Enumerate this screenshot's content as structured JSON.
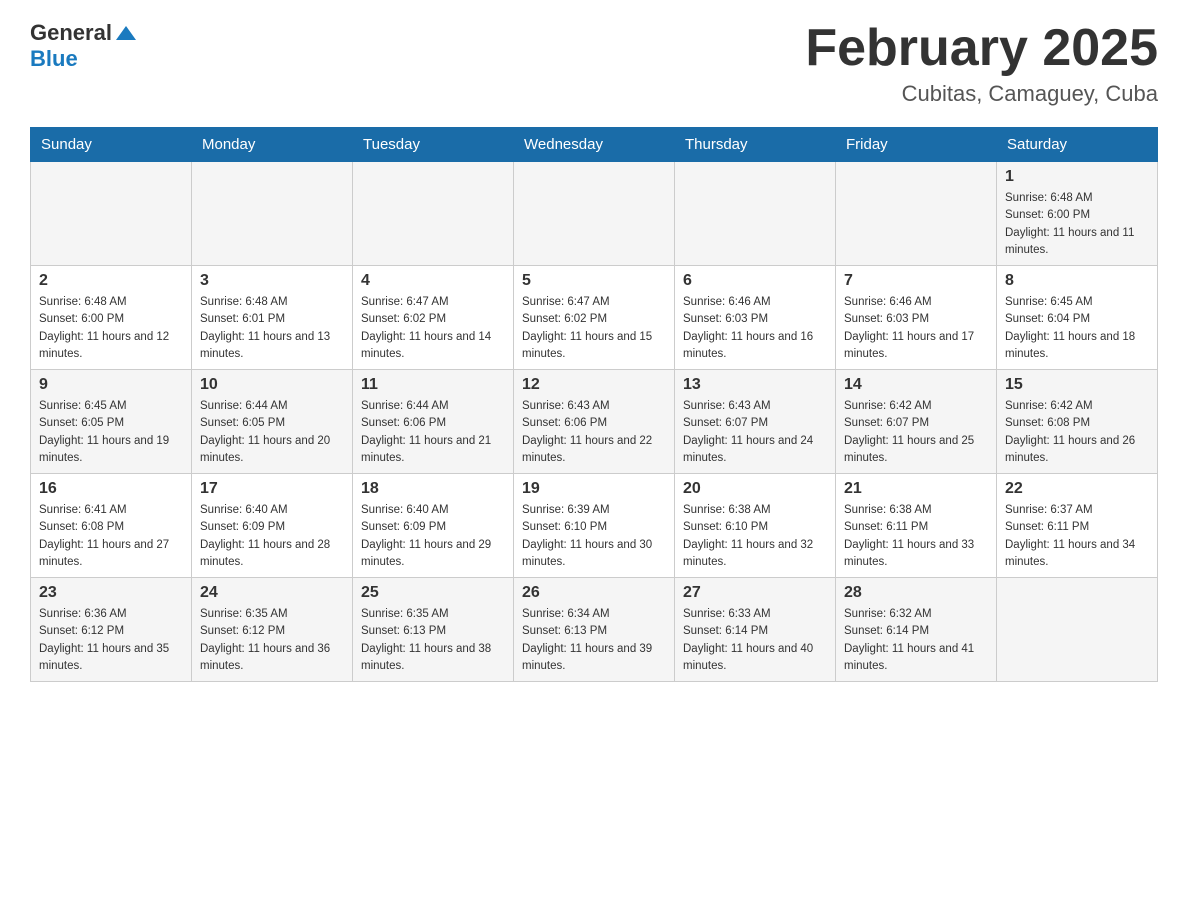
{
  "header": {
    "logo": {
      "general": "General",
      "blue": "Blue"
    },
    "title": "February 2025",
    "subtitle": "Cubitas, Camaguey, Cuba"
  },
  "weekdays": [
    "Sunday",
    "Monday",
    "Tuesday",
    "Wednesday",
    "Thursday",
    "Friday",
    "Saturday"
  ],
  "weeks": [
    [
      {
        "day": "",
        "info": ""
      },
      {
        "day": "",
        "info": ""
      },
      {
        "day": "",
        "info": ""
      },
      {
        "day": "",
        "info": ""
      },
      {
        "day": "",
        "info": ""
      },
      {
        "day": "",
        "info": ""
      },
      {
        "day": "1",
        "info": "Sunrise: 6:48 AM\nSunset: 6:00 PM\nDaylight: 11 hours and 11 minutes."
      }
    ],
    [
      {
        "day": "2",
        "info": "Sunrise: 6:48 AM\nSunset: 6:00 PM\nDaylight: 11 hours and 12 minutes."
      },
      {
        "day": "3",
        "info": "Sunrise: 6:48 AM\nSunset: 6:01 PM\nDaylight: 11 hours and 13 minutes."
      },
      {
        "day": "4",
        "info": "Sunrise: 6:47 AM\nSunset: 6:02 PM\nDaylight: 11 hours and 14 minutes."
      },
      {
        "day": "5",
        "info": "Sunrise: 6:47 AM\nSunset: 6:02 PM\nDaylight: 11 hours and 15 minutes."
      },
      {
        "day": "6",
        "info": "Sunrise: 6:46 AM\nSunset: 6:03 PM\nDaylight: 11 hours and 16 minutes."
      },
      {
        "day": "7",
        "info": "Sunrise: 6:46 AM\nSunset: 6:03 PM\nDaylight: 11 hours and 17 minutes."
      },
      {
        "day": "8",
        "info": "Sunrise: 6:45 AM\nSunset: 6:04 PM\nDaylight: 11 hours and 18 minutes."
      }
    ],
    [
      {
        "day": "9",
        "info": "Sunrise: 6:45 AM\nSunset: 6:05 PM\nDaylight: 11 hours and 19 minutes."
      },
      {
        "day": "10",
        "info": "Sunrise: 6:44 AM\nSunset: 6:05 PM\nDaylight: 11 hours and 20 minutes."
      },
      {
        "day": "11",
        "info": "Sunrise: 6:44 AM\nSunset: 6:06 PM\nDaylight: 11 hours and 21 minutes."
      },
      {
        "day": "12",
        "info": "Sunrise: 6:43 AM\nSunset: 6:06 PM\nDaylight: 11 hours and 22 minutes."
      },
      {
        "day": "13",
        "info": "Sunrise: 6:43 AM\nSunset: 6:07 PM\nDaylight: 11 hours and 24 minutes."
      },
      {
        "day": "14",
        "info": "Sunrise: 6:42 AM\nSunset: 6:07 PM\nDaylight: 11 hours and 25 minutes."
      },
      {
        "day": "15",
        "info": "Sunrise: 6:42 AM\nSunset: 6:08 PM\nDaylight: 11 hours and 26 minutes."
      }
    ],
    [
      {
        "day": "16",
        "info": "Sunrise: 6:41 AM\nSunset: 6:08 PM\nDaylight: 11 hours and 27 minutes."
      },
      {
        "day": "17",
        "info": "Sunrise: 6:40 AM\nSunset: 6:09 PM\nDaylight: 11 hours and 28 minutes."
      },
      {
        "day": "18",
        "info": "Sunrise: 6:40 AM\nSunset: 6:09 PM\nDaylight: 11 hours and 29 minutes."
      },
      {
        "day": "19",
        "info": "Sunrise: 6:39 AM\nSunset: 6:10 PM\nDaylight: 11 hours and 30 minutes."
      },
      {
        "day": "20",
        "info": "Sunrise: 6:38 AM\nSunset: 6:10 PM\nDaylight: 11 hours and 32 minutes."
      },
      {
        "day": "21",
        "info": "Sunrise: 6:38 AM\nSunset: 6:11 PM\nDaylight: 11 hours and 33 minutes."
      },
      {
        "day": "22",
        "info": "Sunrise: 6:37 AM\nSunset: 6:11 PM\nDaylight: 11 hours and 34 minutes."
      }
    ],
    [
      {
        "day": "23",
        "info": "Sunrise: 6:36 AM\nSunset: 6:12 PM\nDaylight: 11 hours and 35 minutes."
      },
      {
        "day": "24",
        "info": "Sunrise: 6:35 AM\nSunset: 6:12 PM\nDaylight: 11 hours and 36 minutes."
      },
      {
        "day": "25",
        "info": "Sunrise: 6:35 AM\nSunset: 6:13 PM\nDaylight: 11 hours and 38 minutes."
      },
      {
        "day": "26",
        "info": "Sunrise: 6:34 AM\nSunset: 6:13 PM\nDaylight: 11 hours and 39 minutes."
      },
      {
        "day": "27",
        "info": "Sunrise: 6:33 AM\nSunset: 6:14 PM\nDaylight: 11 hours and 40 minutes."
      },
      {
        "day": "28",
        "info": "Sunrise: 6:32 AM\nSunset: 6:14 PM\nDaylight: 11 hours and 41 minutes."
      },
      {
        "day": "",
        "info": ""
      }
    ]
  ]
}
